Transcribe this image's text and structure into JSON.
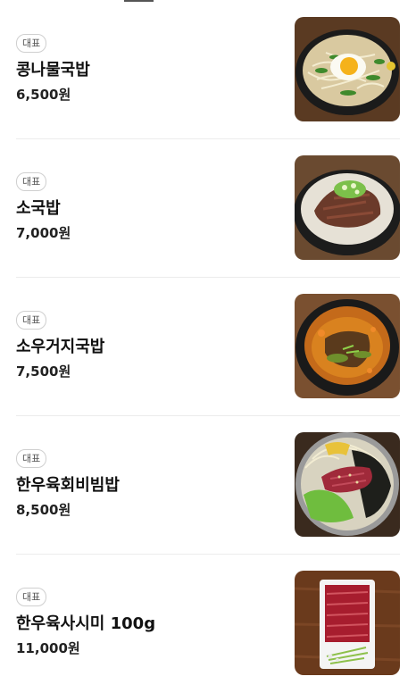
{
  "menu": {
    "items": [
      {
        "badge": "대표",
        "name": "콩나물국밥",
        "price": "6,500원",
        "icon": "bean-sprout-soup-photo"
      },
      {
        "badge": "대표",
        "name": "소국밥",
        "price": "7,000원",
        "icon": "beef-soup-photo"
      },
      {
        "badge": "대표",
        "name": "소우거지국밥",
        "price": "7,500원",
        "icon": "cabbage-beef-soup-photo"
      },
      {
        "badge": "대표",
        "name": "한우육회비빔밥",
        "price": "8,500원",
        "icon": "beef-tartare-bibimbap-photo"
      },
      {
        "badge": "대표",
        "name": "한우육사시미 100g",
        "price": "11,000원",
        "icon": "beef-sashimi-photo"
      }
    ]
  }
}
